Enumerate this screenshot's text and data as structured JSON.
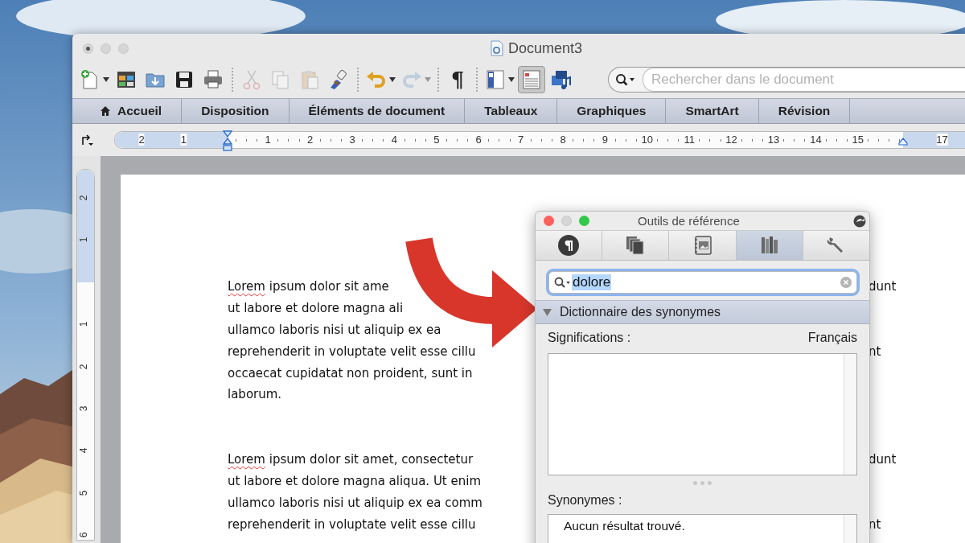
{
  "window": {
    "title": "Document3",
    "active": false,
    "unsaved": true
  },
  "toolbar": {
    "groups": [
      [
        {
          "kind": "new",
          "dropdown": true,
          "disabled": false,
          "selected": false
        },
        {
          "kind": "gallery",
          "dropdown": false,
          "disabled": false,
          "selected": false
        },
        {
          "kind": "open",
          "dropdown": false,
          "disabled": false,
          "selected": false
        },
        {
          "kind": "save",
          "dropdown": false,
          "disabled": false,
          "selected": false
        },
        {
          "kind": "print",
          "dropdown": false,
          "disabled": false,
          "selected": false
        }
      ],
      [
        {
          "kind": "cut",
          "dropdown": false,
          "disabled": true,
          "selected": false
        },
        {
          "kind": "copy",
          "dropdown": false,
          "disabled": true,
          "selected": false
        },
        {
          "kind": "paste",
          "dropdown": false,
          "disabled": true,
          "selected": false
        },
        {
          "kind": "painter",
          "dropdown": false,
          "disabled": false,
          "selected": false
        }
      ],
      [
        {
          "kind": "undo",
          "dropdown": true,
          "disabled": false,
          "selected": false
        },
        {
          "kind": "redo",
          "dropdown": true,
          "disabled": true,
          "selected": false
        }
      ],
      [
        {
          "kind": "pilcrow",
          "label": "¶",
          "dropdown": false,
          "disabled": false,
          "selected": false
        }
      ],
      [
        {
          "kind": "sidebar",
          "dropdown": true,
          "disabled": false,
          "selected": false
        },
        {
          "kind": "layout",
          "dropdown": false,
          "disabled": false,
          "selected": true
        },
        {
          "kind": "media",
          "dropdown": false,
          "disabled": false,
          "selected": false
        }
      ]
    ],
    "search": {
      "placeholder": "Rechercher dans le document"
    }
  },
  "ribbon": {
    "tabs": [
      {
        "label": "Accueil",
        "home_icon": true,
        "selected": false
      },
      {
        "label": "Disposition",
        "home_icon": false,
        "selected": false
      },
      {
        "label": "Éléments de document",
        "home_icon": false,
        "selected": false
      },
      {
        "label": "Tableaux",
        "home_icon": false,
        "selected": false
      },
      {
        "label": "Graphiques",
        "home_icon": false,
        "selected": false
      },
      {
        "label": "SmartArt",
        "home_icon": false,
        "selected": false
      },
      {
        "label": "Révision",
        "home_icon": false,
        "selected": false
      }
    ]
  },
  "ruler": {
    "labels": [
      "2",
      "1",
      "1",
      "2",
      "3",
      "4",
      "5",
      "6",
      "7",
      "8",
      "9",
      "10",
      "11",
      "12",
      "13",
      "14",
      "15",
      "17"
    ]
  },
  "vertical_ruler": {
    "labels": [
      "2",
      "1",
      "1",
      "2",
      "3",
      "4",
      "5",
      "6"
    ]
  },
  "document": {
    "paragraphs": [
      {
        "lines": [
          {
            "text": "Lorem ipsum dolor sit ame",
            "spelling_error": true,
            "right": "dunt"
          },
          {
            "text": "ut labore et dolore magna ali",
            "spelling_error": false
          },
          {
            "text": "ullamco laboris nisi ut aliquip ex ea",
            "spelling_error": false
          },
          {
            "text": "reprehenderit in voluptate velit esse cillu",
            "spelling_error": false,
            "right": "nt"
          },
          {
            "text": "occaecat cupidatat non proident, sunt in",
            "spelling_error": false
          },
          {
            "text": "laborum.",
            "spelling_error": false
          }
        ]
      },
      {
        "lines": [
          {
            "text": "Lorem ipsum dolor sit amet, consectetur",
            "spelling_error": true,
            "right": "dunt"
          },
          {
            "text": "ut labore et dolore magna aliqua. Ut enim",
            "spelling_error": false
          },
          {
            "text": "ullamco laboris nisi ut aliquip ex ea comm",
            "spelling_error": false
          },
          {
            "text": "reprehenderit in voluptate velit esse cillu",
            "spelling_error": false,
            "right": "nt"
          }
        ]
      }
    ]
  },
  "reference_panel": {
    "title": "Outils de référence",
    "active": true,
    "tabs": [
      {
        "kind": "paragraph",
        "selected": false
      },
      {
        "kind": "documents",
        "selected": false
      },
      {
        "kind": "scrapbook",
        "selected": false
      },
      {
        "kind": "books",
        "selected": true
      },
      {
        "kind": "wrench",
        "selected": false
      }
    ],
    "search": {
      "value": "dolore",
      "text_selected": true
    },
    "section": {
      "title": "Dictionnaire des synonymes",
      "expanded": true
    },
    "meanings": {
      "label": "Significations :",
      "language": "Français"
    },
    "synonyms": {
      "label": "Synonymes :",
      "items": [
        "Aucun résultat trouvé."
      ]
    }
  }
}
